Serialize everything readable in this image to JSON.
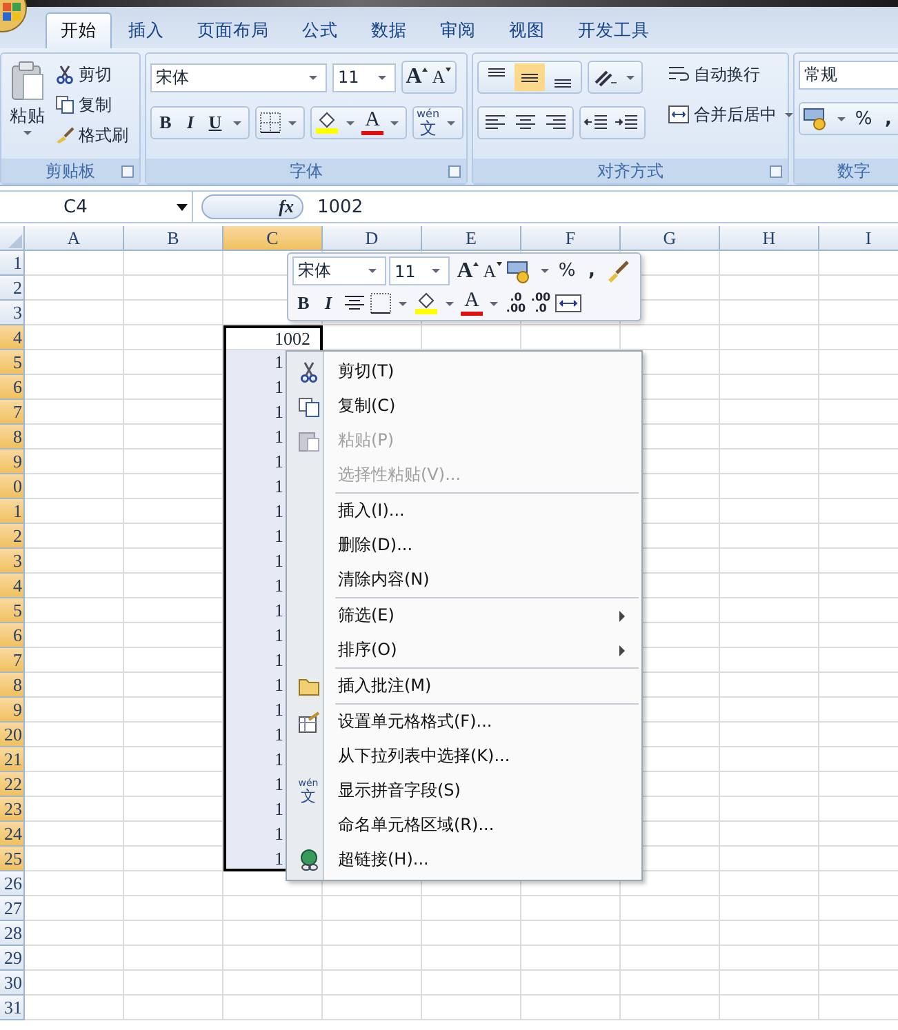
{
  "ribbon": {
    "tabs": [
      {
        "label": "开始",
        "selected": true
      },
      {
        "label": "插入",
        "selected": false
      },
      {
        "label": "页面布局",
        "selected": false
      },
      {
        "label": "公式",
        "selected": false
      },
      {
        "label": "数据",
        "selected": false
      },
      {
        "label": "审阅",
        "selected": false
      },
      {
        "label": "视图",
        "selected": false
      },
      {
        "label": "开发工具",
        "selected": false
      }
    ],
    "clipboard": {
      "title": "剪贴板",
      "paste": "粘贴",
      "cut": "剪切",
      "copy": "复制",
      "format_painter": "格式刷"
    },
    "font": {
      "title": "字体",
      "font_name": "宋体",
      "font_size": "11",
      "grow": "A",
      "shrink": "A",
      "bold": "B",
      "italic": "I",
      "underline": "U",
      "font_color": "A",
      "phonetic_pinyin": "wén",
      "phonetic_char": "文"
    },
    "alignment": {
      "title": "对齐方式",
      "vertical": [
        {
          "selected": false
        },
        {
          "selected": true
        },
        {
          "selected": false
        }
      ],
      "wrap_text": "自动换行",
      "merge_center": "合并后居中"
    },
    "number": {
      "title": "数字",
      "format": "常规",
      "percent": "%",
      "comma": ","
    }
  },
  "formula_bar": {
    "name_box": "C4",
    "fx": "fx",
    "value": "1002"
  },
  "sheet": {
    "columns": [
      {
        "label": "A",
        "selected": false
      },
      {
        "label": "B",
        "selected": false
      },
      {
        "label": "C",
        "selected": true
      },
      {
        "label": "D",
        "selected": false
      },
      {
        "label": "E",
        "selected": false
      },
      {
        "label": "F",
        "selected": false
      },
      {
        "label": "G",
        "selected": false
      },
      {
        "label": "H",
        "selected": false
      },
      {
        "label": "I",
        "selected": false
      }
    ],
    "rows": [
      {
        "header": "1",
        "selected": false
      },
      {
        "header": "2",
        "selected": false
      },
      {
        "header": "3",
        "selected": false
      },
      {
        "header": "4",
        "selected": true,
        "c": "1002"
      },
      {
        "header": "5",
        "selected": true,
        "c": "1"
      },
      {
        "header": "6",
        "selected": true,
        "c": "1"
      },
      {
        "header": "7",
        "selected": true,
        "c": "1"
      },
      {
        "header": "8",
        "selected": true,
        "c": "1"
      },
      {
        "header": "9",
        "selected": true,
        "c": "1"
      },
      {
        "header": "0",
        "selected": true,
        "c": "1"
      },
      {
        "header": "1",
        "selected": true,
        "c": "1"
      },
      {
        "header": "2",
        "selected": true,
        "c": "1"
      },
      {
        "header": "3",
        "selected": true,
        "c": "1"
      },
      {
        "header": "4",
        "selected": true,
        "c": "1"
      },
      {
        "header": "5",
        "selected": true,
        "c": "1"
      },
      {
        "header": "6",
        "selected": true,
        "c": "1"
      },
      {
        "header": "7",
        "selected": true,
        "c": "1"
      },
      {
        "header": "8",
        "selected": true,
        "c": "1"
      },
      {
        "header": "9",
        "selected": true,
        "c": "1"
      },
      {
        "header": "20",
        "selected": true,
        "c": "1"
      },
      {
        "header": "21",
        "selected": true,
        "c": "1"
      },
      {
        "header": "22",
        "selected": true,
        "c": "1"
      },
      {
        "header": "23",
        "selected": true,
        "c": "1"
      },
      {
        "header": "24",
        "selected": true,
        "c": "1"
      },
      {
        "header": "25",
        "selected": true,
        "c": "1"
      },
      {
        "header": "26",
        "selected": false
      },
      {
        "header": "27",
        "selected": false
      },
      {
        "header": "28",
        "selected": false
      },
      {
        "header": "29",
        "selected": false
      },
      {
        "header": "30",
        "selected": false
      },
      {
        "header": "31",
        "selected": false
      }
    ]
  },
  "mini_toolbar": {
    "font_name": "宋体",
    "font_size": "11",
    "grow": "A",
    "shrink": "A",
    "percent": "%",
    "comma": ",",
    "bold": "B",
    "italic": "I",
    "font_color": "A",
    "increase_decimal": [
      ".0",
      ".00"
    ],
    "decrease_decimal": [
      ".00",
      ".0"
    ]
  },
  "context_menu": [
    {
      "label": "剪切(T)",
      "disabled": false,
      "submenu": false,
      "separator_before": false
    },
    {
      "label": "复制(C)",
      "disabled": false,
      "submenu": false,
      "separator_before": false
    },
    {
      "label": "粘贴(P)",
      "disabled": true,
      "submenu": false,
      "separator_before": false
    },
    {
      "label": "选择性粘贴(V)...",
      "disabled": true,
      "submenu": false,
      "separator_before": false
    },
    {
      "label": "插入(I)...",
      "disabled": false,
      "submenu": false,
      "separator_before": true
    },
    {
      "label": "删除(D)...",
      "disabled": false,
      "submenu": false,
      "separator_before": false
    },
    {
      "label": "清除内容(N)",
      "disabled": false,
      "submenu": false,
      "separator_before": false
    },
    {
      "label": "筛选(E)",
      "disabled": false,
      "submenu": true,
      "separator_before": true
    },
    {
      "label": "排序(O)",
      "disabled": false,
      "submenu": true,
      "separator_before": false
    },
    {
      "label": "插入批注(M)",
      "disabled": false,
      "submenu": false,
      "separator_before": true
    },
    {
      "label": "设置单元格格式(F)...",
      "disabled": false,
      "submenu": false,
      "separator_before": true
    },
    {
      "label": "从下拉列表中选择(K)...",
      "disabled": false,
      "submenu": false,
      "separator_before": false
    },
    {
      "label": "显示拼音字段(S)",
      "disabled": false,
      "submenu": false,
      "separator_before": false,
      "icon_pinyin": "wén",
      "icon_char": "文"
    },
    {
      "label": "命名单元格区域(R)...",
      "disabled": false,
      "submenu": false,
      "separator_before": false
    },
    {
      "label": "超链接(H)...",
      "disabled": false,
      "submenu": false,
      "separator_before": false
    }
  ]
}
